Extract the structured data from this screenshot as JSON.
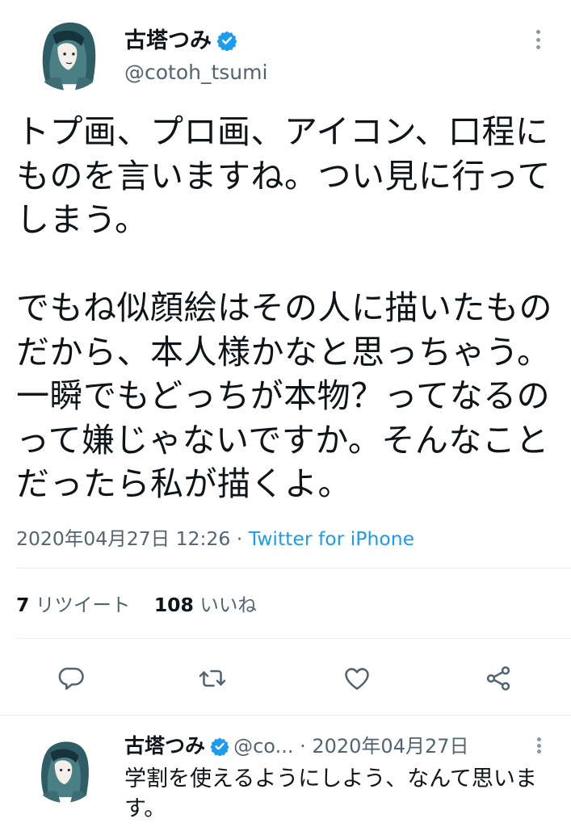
{
  "tweet": {
    "author_name": "古塔つみ",
    "author_handle": "@cotoh_tsumi",
    "text_paragraph_1": "トプ画、プロ画、アイコン、口程にものを言いますね。つい見に行ってしまう。",
    "text_paragraph_2": "でもね似顔絵はその人に描いたものだから、本人様かなと思っちゃう。一瞬でもどっちが本物？ってなるのって嫌じゃないですか。そんなことだったら私が描くよ。",
    "timestamp": "2020年04月27日 12:26",
    "separator": " · ",
    "source": "Twitter for iPhone",
    "retweet_count": "7",
    "retweet_label": "リツイート",
    "like_count": "108",
    "like_label": "いいね"
  },
  "reply": {
    "author_name": "古塔つみ",
    "author_handle": "@co...",
    "separator": " · ",
    "date": "2020年04月27日",
    "text": "学割を使えるようにしよう、なんて思います。"
  },
  "icons": {
    "verified": "verified-badge-icon",
    "more": "more-options-icon",
    "reply": "reply-icon",
    "retweet": "retweet-icon",
    "like": "heart-icon",
    "share": "share-icon"
  },
  "colors": {
    "text": "#0f1419",
    "secondary": "#536471",
    "link": "#1d9bf0",
    "verified": "#1d9bf0",
    "icon": "#536471",
    "divider": "#e6ecf0"
  }
}
